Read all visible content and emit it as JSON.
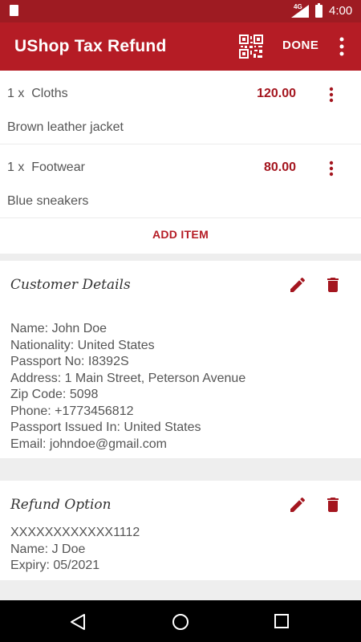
{
  "status_bar": {
    "network": "4G",
    "time": "4:00"
  },
  "app_bar": {
    "title": "UShop Tax Refund",
    "done_label": "DONE"
  },
  "items": [
    {
      "qty_prefix": "1 x",
      "category": "Cloths",
      "price": "120.00",
      "description": "Brown leather jacket"
    },
    {
      "qty_prefix": "1 x",
      "category": "Footwear",
      "price": "80.00",
      "description": "Blue sneakers"
    }
  ],
  "add_item_label": "ADD ITEM",
  "customer": {
    "title": "Customer Details",
    "lines": [
      "Name:  John Doe",
      "Nationality:  United States",
      "Passport No:  I8392S",
      "Address:  1 Main Street, Peterson Avenue",
      "Zip Code:  5098",
      "Phone:  +1773456812",
      "Passport Issued In:  United States",
      "Email:  johndoe@gmail.com"
    ]
  },
  "refund": {
    "title": "Refund Option",
    "lines": [
      "XXXXXXXXXXXX1112",
      "Name:  J Doe",
      "Expiry:  05/2021"
    ]
  },
  "colors": {
    "primary": "#b51c25",
    "status_bar": "#9e1b22",
    "accent_text": "#a4161f"
  },
  "icons": [
    "sd-card-icon",
    "signal-icon",
    "battery-icon",
    "qr-code-icon",
    "more-vert-icon",
    "pencil-icon",
    "trash-icon",
    "back-icon",
    "home-icon",
    "recents-icon"
  ]
}
